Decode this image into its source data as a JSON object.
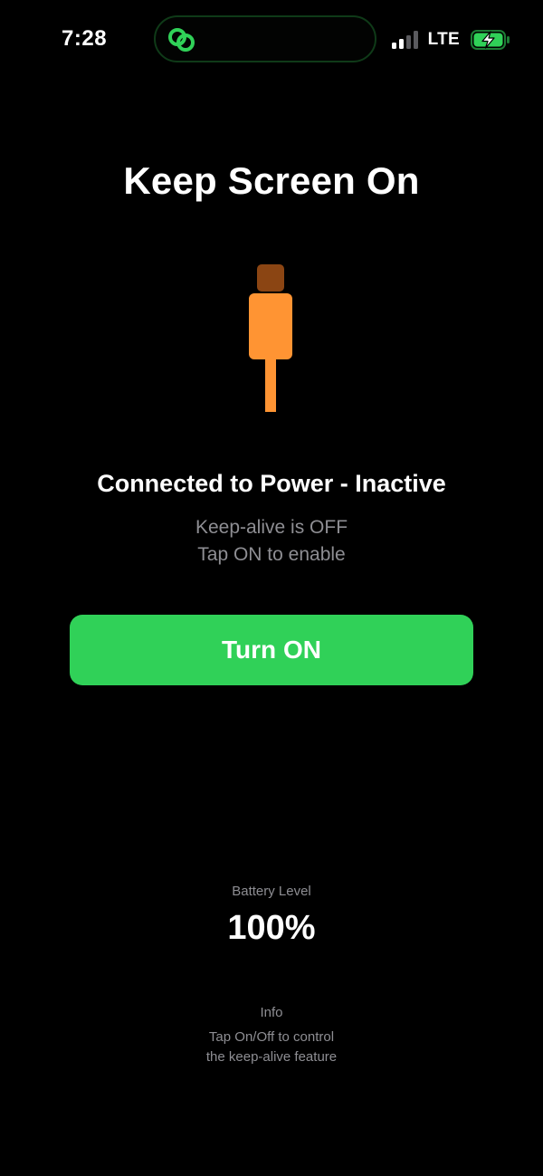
{
  "status_bar": {
    "time": "7:28",
    "network": "LTE",
    "battery_percent": 100,
    "charging": true,
    "signal_bars_active": 2,
    "signal_bars_total": 4,
    "island_icon": "link-rings-icon",
    "colors": {
      "island_accent": "#30d158",
      "battery_fill": "#30d158"
    }
  },
  "app": {
    "title": "Keep Screen On",
    "plug_icon": "power-plug-icon",
    "connection_status": "Connected to Power - Inactive",
    "keepalive_line1": "Keep-alive is OFF",
    "keepalive_line2": "Tap ON to enable",
    "button_label": "Turn ON",
    "colors": {
      "button": "#30d158",
      "plug_body": "#ff9433",
      "plug_tip": "#8b4513",
      "secondary_text": "#8e8e93"
    }
  },
  "battery": {
    "label": "Battery Level",
    "value": "100%"
  },
  "info": {
    "label": "Info",
    "line1": "Tap On/Off to control",
    "line2": "the keep-alive feature"
  }
}
